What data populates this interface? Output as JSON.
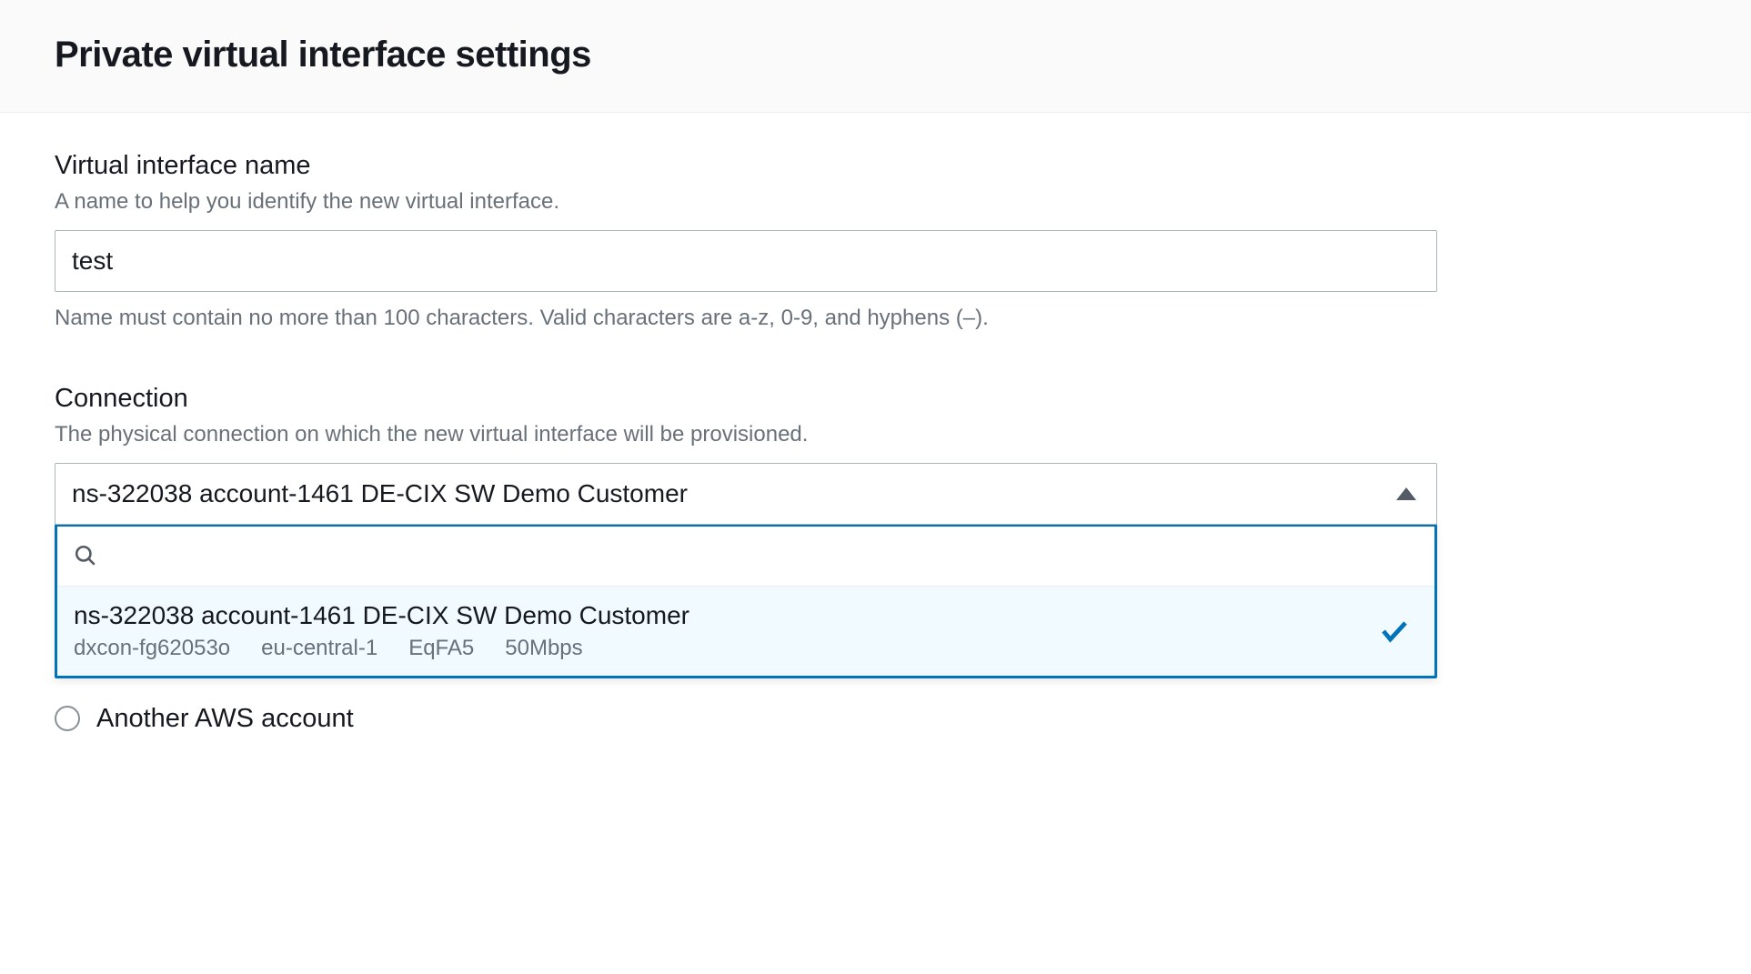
{
  "panel": {
    "title": "Private virtual interface settings"
  },
  "vif_name": {
    "label": "Virtual interface name",
    "description": "A name to help you identify the new virtual interface.",
    "value": "test",
    "hint": "Name must contain no more than 100 characters. Valid characters are a-z, 0-9, and hyphens (–)."
  },
  "connection": {
    "label": "Connection",
    "description": "The physical connection on which the new virtual interface will be provisioned.",
    "selected": "ns-322038 account-1461 DE-CIX SW Demo Customer",
    "search_value": "",
    "option": {
      "title": "ns-322038 account-1461 DE-CIX SW Demo Customer",
      "id": "dxcon-fg62053o",
      "region": "eu-central-1",
      "location": "EqFA5",
      "bandwidth": "50Mbps"
    }
  },
  "account_radio": {
    "label": "Another AWS account"
  }
}
